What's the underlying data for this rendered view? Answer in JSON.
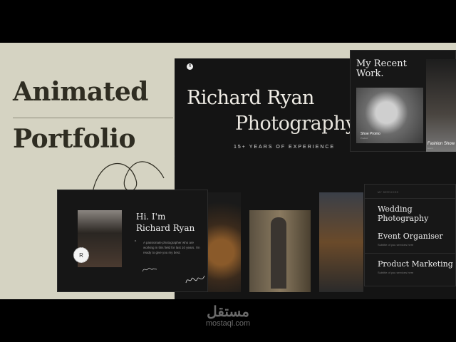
{
  "headline": {
    "line1": "Animated",
    "line2": "Portfolio"
  },
  "hero": {
    "logo_letter": "R",
    "name": "Richard Ryan",
    "profession": "Photography",
    "tagline": "15+ YEARS OF EXPERIENCE"
  },
  "recent_work": {
    "title_line1": "My Recent",
    "title_line2": "Work.",
    "items": [
      {
        "title": "Shoe Promo",
        "sub": "Product"
      },
      {
        "title": "Fashion Show",
        "sub": "Event"
      }
    ]
  },
  "intro": {
    "greeting": "Hi. I'm",
    "name": "Richard Ryan",
    "badge_letter": "R",
    "quote_mark": "“",
    "bio": "A passionate photographer who are working in this field for last 10 years. I'm ready to give you my best."
  },
  "services": {
    "label": "MY SERVICES",
    "items": [
      {
        "title": "Wedding Photography",
        "sub": "Subtitle of you services here"
      },
      {
        "title": "Event Organiser",
        "sub": "Subtitle of you services here"
      },
      {
        "title": "Product Marketing",
        "sub": "Subtitle of you services here"
      }
    ]
  },
  "watermark": {
    "arabic": "مستقل",
    "domain": "mostaql.com"
  }
}
